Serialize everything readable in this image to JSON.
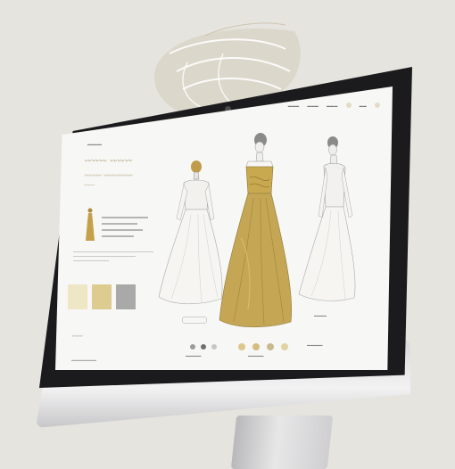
{
  "colors": {
    "gold": "#c4ad62",
    "gold_dark": "#9c8a4a",
    "cream": "#ecdfb5",
    "sand": "#d8c88e",
    "gray": "#a6a6a6",
    "ink": "#2c2c2c",
    "bezel": "#1b1b1d"
  },
  "icons": {
    "profile": "avatar-circle"
  },
  "swatches": [
    {
      "name": "cream-swatch",
      "color": "#efe6c6"
    },
    {
      "name": "sand-swatch",
      "color": "#ddcb8f"
    },
    {
      "name": "gray-swatch",
      "color": "#a9a9a9"
    }
  ],
  "color_dots_left": [
    "#9b9b9b",
    "#6f6f6f",
    "#c7c7c7"
  ],
  "color_dots_right": [
    "#ddc78c",
    "#d4bd7e",
    "#c9b98e",
    "#e1d3a6"
  ]
}
